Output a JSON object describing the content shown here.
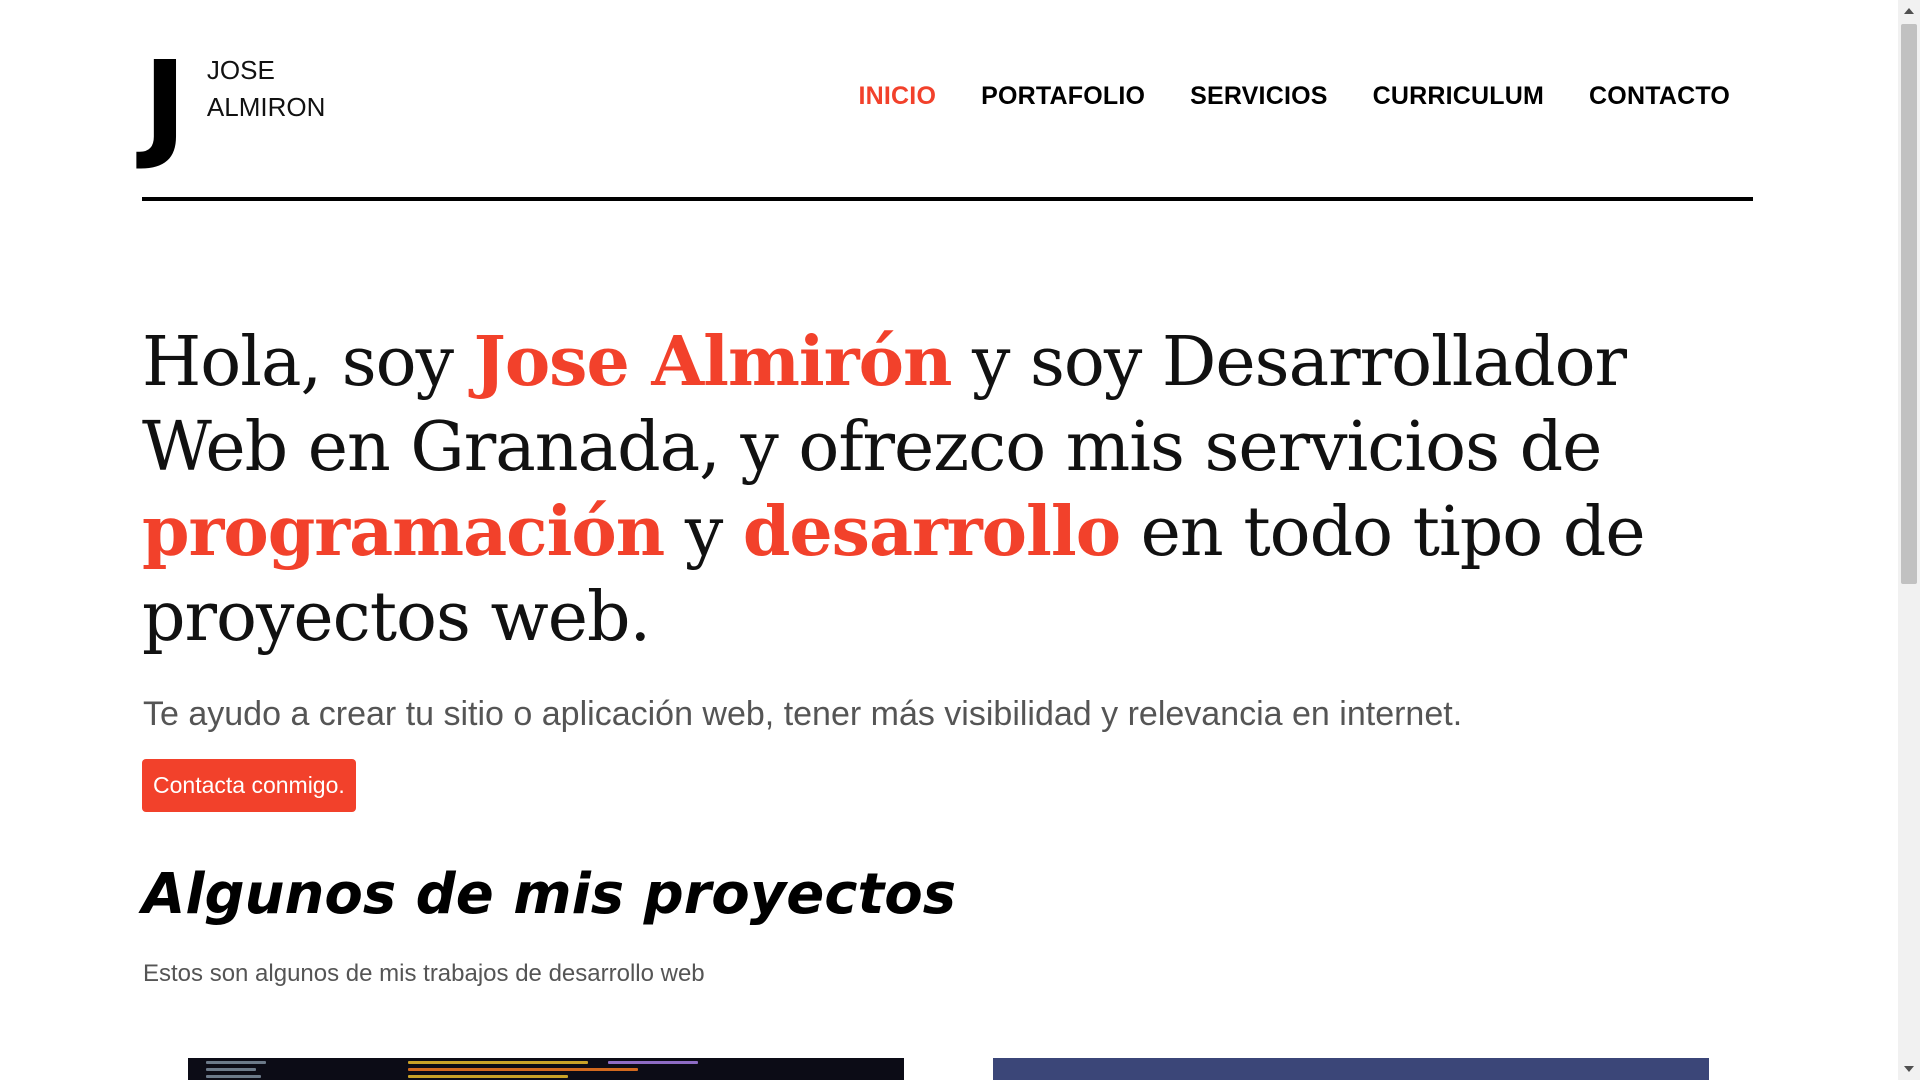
{
  "logo": {
    "mark": "J",
    "line1": "JOSE",
    "line2": "ALMIRON"
  },
  "nav": {
    "items": [
      {
        "label": "INICIO",
        "active": true
      },
      {
        "label": "PORTAFOLIO",
        "active": false
      },
      {
        "label": "SERVICIOS",
        "active": false
      },
      {
        "label": "CURRICULUM",
        "active": false
      },
      {
        "label": "CONTACTO",
        "active": false
      }
    ]
  },
  "hero": {
    "parts": [
      "Hola, soy ",
      "Jose Almirón",
      " y soy Desarrollador Web en Granada, y ofrezco mis servicios de ",
      "programación",
      " y ",
      "desarrollo",
      " en todo tipo de proyectos web."
    ],
    "subtitle": "Te ayudo a crear tu sitio o aplicación web, tener más visibilidad y relevancia en internet.",
    "cta_label": "Contacta conmigo."
  },
  "projects": {
    "title": "Algunos de mis proyectos",
    "subtitle": "Estos son algunos de mis trabajos de desarrollo web"
  },
  "colors": {
    "accent": "#f2412b",
    "text": "#111111",
    "muted": "#555555",
    "card_dark": "#0c0c16",
    "card_blue": "#3b4678"
  }
}
